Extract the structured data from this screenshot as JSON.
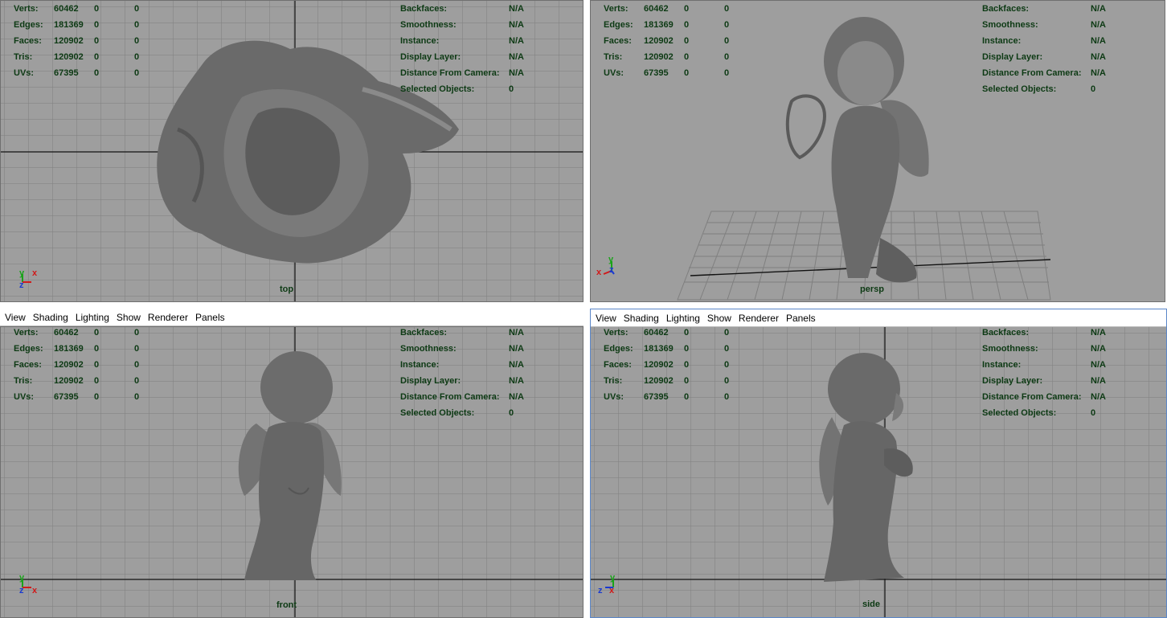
{
  "stats": {
    "left": [
      {
        "label": "Verts:",
        "v1": "60462",
        "v2": "0",
        "v3": "0"
      },
      {
        "label": "Edges:",
        "v1": "181369",
        "v2": "0",
        "v3": "0"
      },
      {
        "label": "Faces:",
        "v1": "120902",
        "v2": "0",
        "v3": "0"
      },
      {
        "label": "Tris:",
        "v1": "120902",
        "v2": "0",
        "v3": "0"
      },
      {
        "label": "UVs:",
        "v1": "67395",
        "v2": "0",
        "v3": "0"
      }
    ],
    "right": [
      {
        "label": "Backfaces:",
        "value": "N/A"
      },
      {
        "label": "Smoothness:",
        "value": "N/A"
      },
      {
        "label": "Instance:",
        "value": "N/A"
      },
      {
        "label": "Display Layer:",
        "value": "N/A"
      },
      {
        "label": "Distance From Camera:",
        "value": "N/A"
      },
      {
        "label": "Selected Objects:",
        "value": "0"
      }
    ]
  },
  "menu": [
    "View",
    "Shading",
    "Lighting",
    "Show",
    "Renderer",
    "Panels"
  ],
  "cameras": {
    "top": "top",
    "persp": "persp",
    "front": "front",
    "side": "side"
  },
  "axes": {
    "x": "x",
    "y": "y",
    "z": "z"
  },
  "colors": {
    "viewport_bg": "#9e9e9e",
    "grid_line": "#7f7f7f",
    "hud_text": "#0d3a14",
    "axis_x": "#d01a1a",
    "axis_y": "#1aa31a",
    "axis_z": "#1a3ad0",
    "model": "#6a6a6a"
  }
}
